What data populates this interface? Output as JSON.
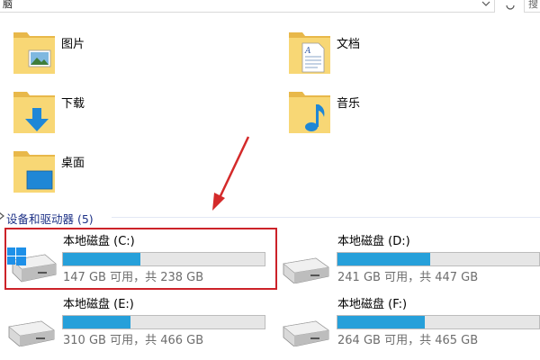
{
  "address_bar": {
    "path_fragment": "脑",
    "search_fragment": "搜"
  },
  "folders": [
    {
      "label": "图片",
      "icon": "pictures-folder-icon"
    },
    {
      "label": "文档",
      "icon": "documents-folder-icon"
    },
    {
      "label": "下载",
      "icon": "downloads-folder-icon"
    },
    {
      "label": "音乐",
      "icon": "music-folder-icon"
    },
    {
      "label": "桌面",
      "icon": "desktop-folder-icon"
    }
  ],
  "devices_section": {
    "label": "设备和驱动器 (5)"
  },
  "drives": [
    {
      "name": "本地磁盘 (C:)",
      "free_text": "147 GB 可用，共 238 GB",
      "used_fraction": 0.382,
      "system": true
    },
    {
      "name": "本地磁盘 (D:)",
      "free_text": "241 GB 可用，共 447 GB",
      "used_fraction": 0.461,
      "system": false
    },
    {
      "name": "本地磁盘 (E:)",
      "free_text": "310 GB 可用，共 466 GB",
      "used_fraction": 0.335,
      "system": false
    },
    {
      "name": "本地磁盘 (F:)",
      "free_text": "264 GB 可用，共 465 GB",
      "used_fraction": 0.432,
      "system": false
    }
  ],
  "colors": {
    "usage_bar": "#26a0da",
    "highlight_box": "#cc2229",
    "section_header": "#1e3287",
    "folder_yellow": "#f8d775"
  }
}
